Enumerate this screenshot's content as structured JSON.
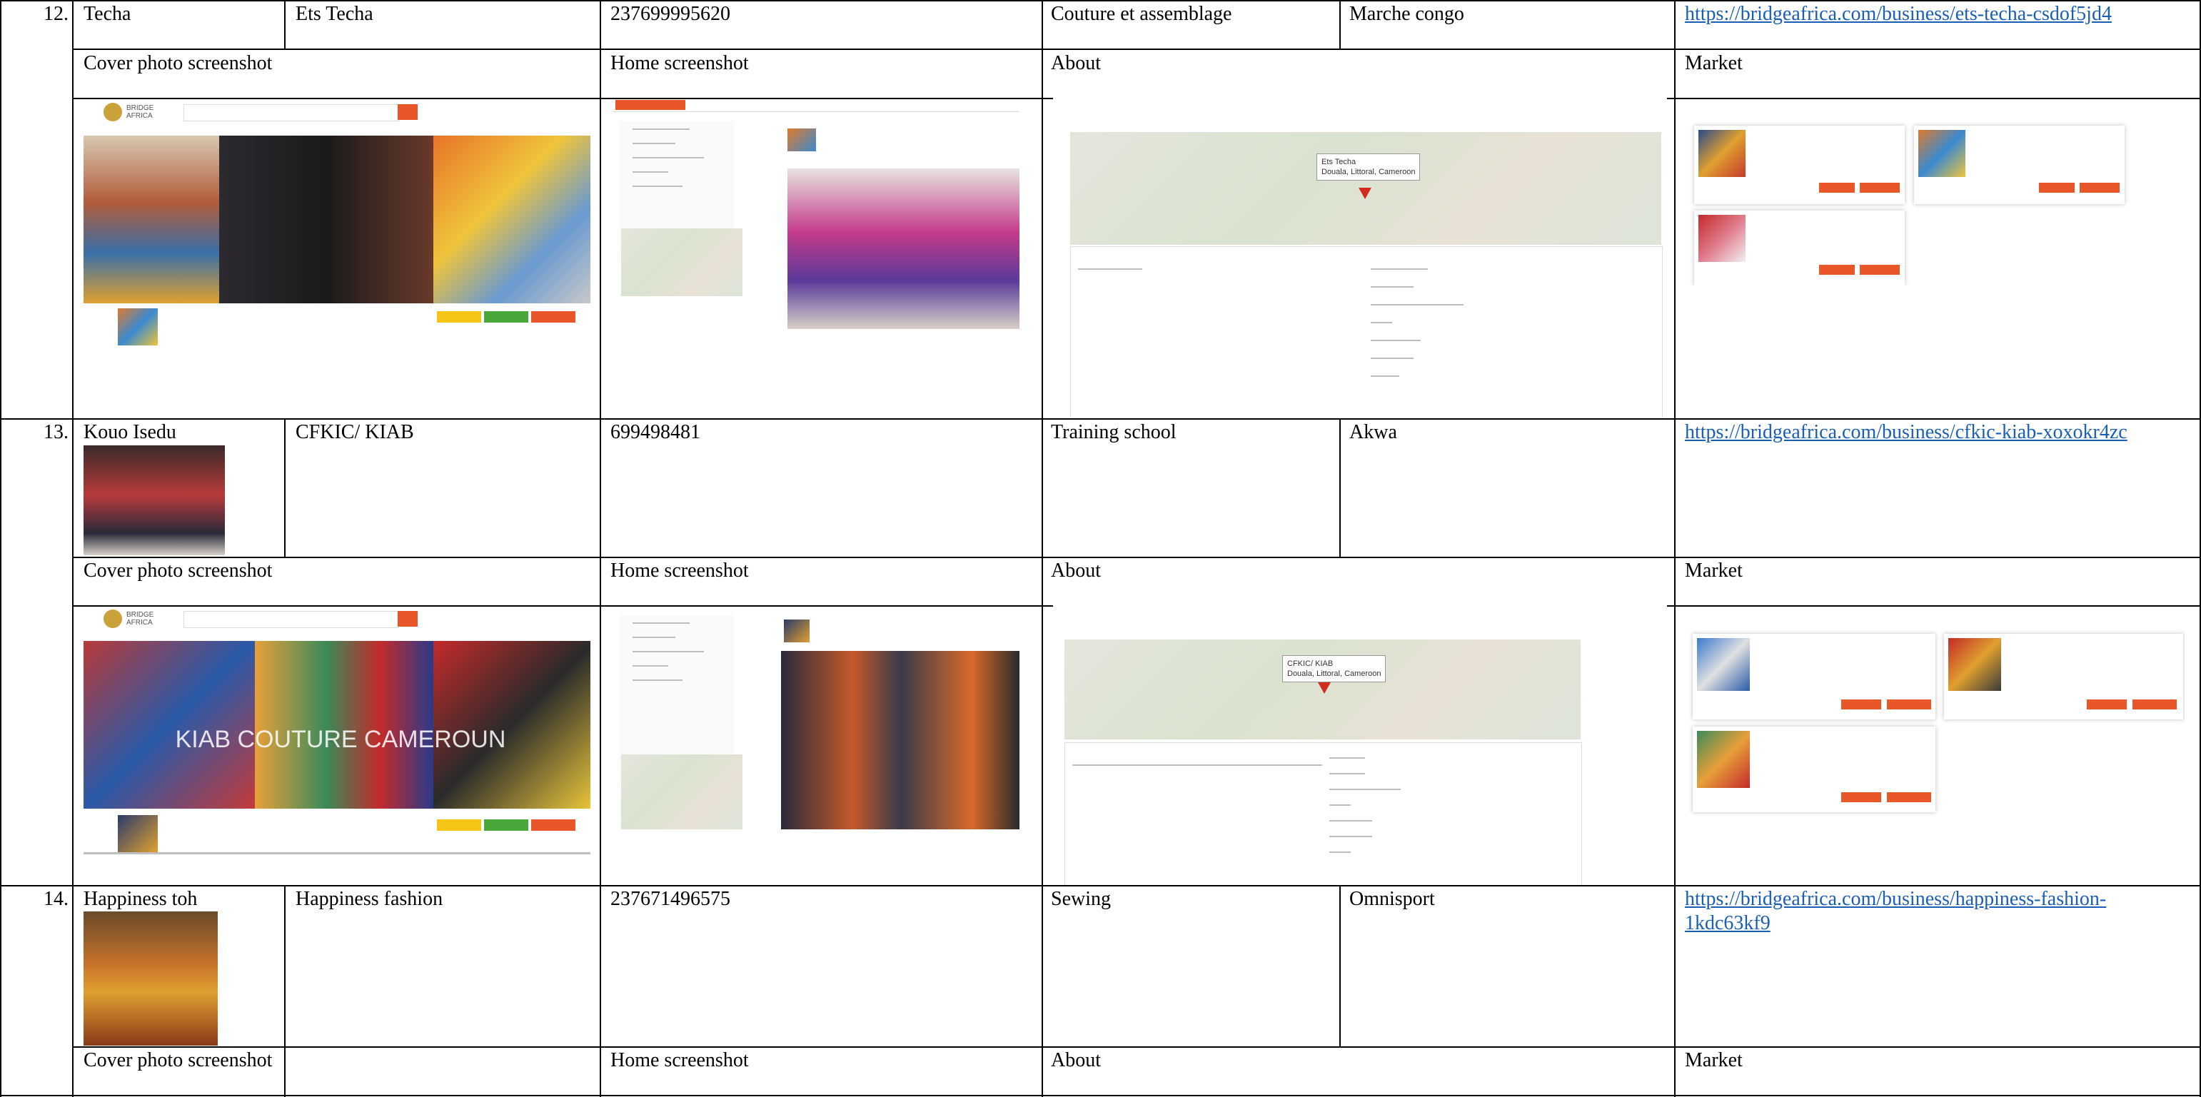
{
  "section_labels": {
    "cover": "Cover photo screenshot",
    "home": "Home screenshot",
    "about": "About",
    "market": "Market"
  },
  "rows": [
    {
      "number": "12.",
      "name": "Techa",
      "business": "Ets Techa",
      "phone": "237699995620",
      "activity": "Couture et assemblage",
      "location": "Marche congo",
      "url": "https://bridgeafrica.com/business/ets-techa-csdof5jd4"
    },
    {
      "number": "13.",
      "name": "Kouo Isedu",
      "business": "CFKIC/ KIAB",
      "phone": "699498481",
      "activity": "Training school",
      "location": "Akwa",
      "url": "https://bridgeafrica.com/business/cfkic-kiab-xoxokr4zc"
    },
    {
      "number": "14.",
      "name": "Happiness toh",
      "business": "Happiness fashion",
      "phone": "237671496575",
      "activity": "Sewing",
      "location": "Omnisport",
      "url_line1": "https://bridgeafrica.com/business/happiness-fashion-",
      "url_line2": "1kdc63kf9"
    }
  ],
  "thumbnails": {
    "logo_text_1": "BRIDGE",
    "logo_text_2": "AFRICA",
    "cover1_banner": "KIAB COUTURE CAMEROUN",
    "map_popup_1": "Ets Techa",
    "map_popup_2": "Douala, Littoral, Cameroon",
    "map_popup_kiab": "CFKIC/ KIAB"
  },
  "colors": {
    "link": "#1a5fb4",
    "brand_orange": "#e8562a",
    "border": "#000000"
  }
}
